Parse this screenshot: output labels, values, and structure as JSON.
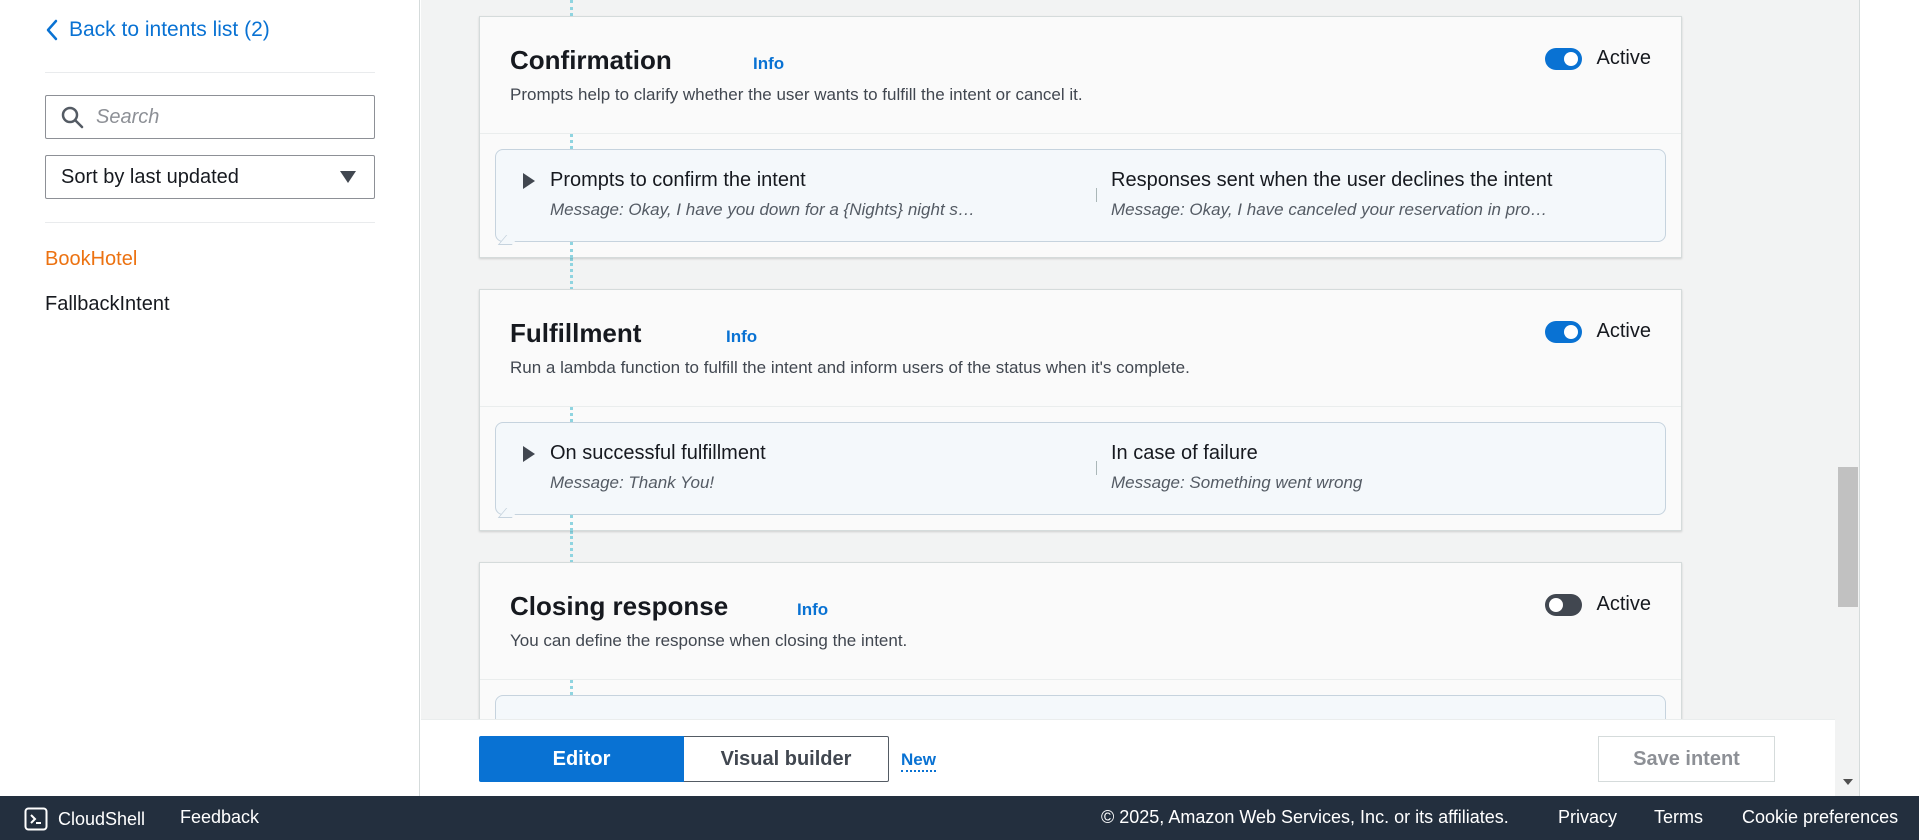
{
  "sidebar": {
    "back_label": "Back to intents list (2)",
    "search_placeholder": "Search",
    "sort_label": "Sort by last updated",
    "intents": [
      {
        "label": "BookHotel",
        "active": true
      },
      {
        "label": "FallbackIntent",
        "active": false
      }
    ]
  },
  "cards": {
    "confirmation": {
      "title": "Confirmation",
      "info": "Info",
      "description": "Prompts help to clarify whether the user wants to fulfill the intent or cancel it.",
      "toggle_label": "Active",
      "toggle_on": true,
      "left_title": "Prompts to confirm the intent",
      "left_message": "Message: Okay, I have you down for a {Nights} night s…",
      "right_title": "Responses sent when the user declines the intent",
      "right_message": "Message: Okay, I have canceled your reservation in pro…"
    },
    "fulfillment": {
      "title": "Fulfillment",
      "info": "Info",
      "description": "Run a lambda function to fulfill the intent and inform users of the status when it's complete.",
      "toggle_label": "Active",
      "toggle_on": true,
      "left_title": "On successful fulfillment",
      "left_message": "Message: Thank You!",
      "right_title": "In case of failure",
      "right_message": "Message: Something went wrong"
    },
    "closing": {
      "title": "Closing response",
      "info": "Info",
      "description": "You can define the response when closing the intent.",
      "toggle_label": "Active",
      "toggle_on": false
    }
  },
  "action_bar": {
    "editor_label": "Editor",
    "visual_builder_label": "Visual builder",
    "new_badge": "New",
    "save_label": "Save intent"
  },
  "footer": {
    "cloudshell": "CloudShell",
    "feedback": "Feedback",
    "copyright": "© 2025, Amazon Web Services, Inc. or its affiliates.",
    "privacy": "Privacy",
    "terms": "Terms",
    "cookie": "Cookie preferences"
  },
  "colors": {
    "accent_blue": "#0972d3",
    "active_orange": "#ec7211",
    "footer_bg": "#232f3e"
  }
}
